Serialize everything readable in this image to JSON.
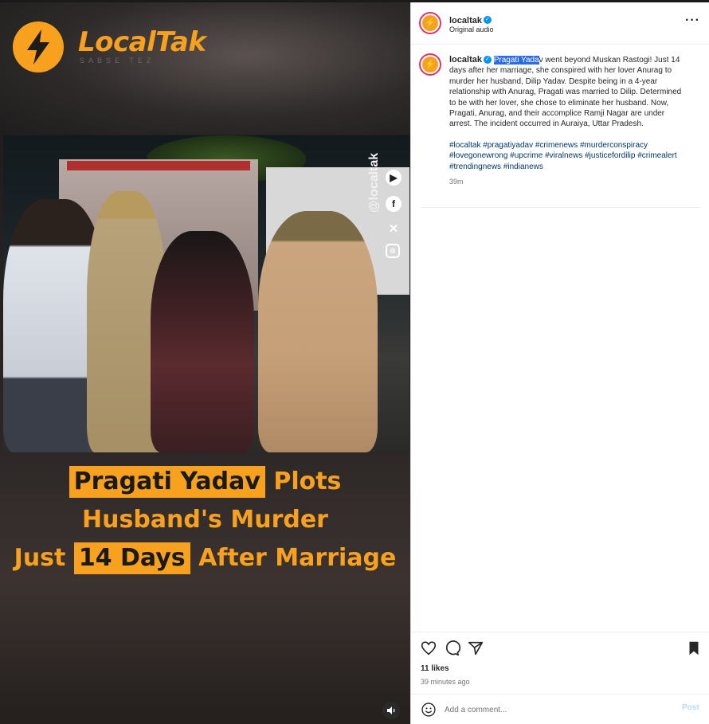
{
  "media": {
    "logo_name": "LocalTak",
    "logo_tagline": "SABSE TEZ",
    "watermark_handle": "@localtak",
    "caption_lines": [
      {
        "highlight": "Pragati Yadav",
        "rest": " Plots"
      },
      {
        "plain": "Husband's Murder"
      },
      {
        "pre": "Just ",
        "highlight": "14 Days",
        "post": " After Marriage"
      }
    ],
    "mute_icon": "speaker-icon"
  },
  "header": {
    "username": "localtak",
    "audio": "Original audio",
    "more_icon": "more-options-icon"
  },
  "post": {
    "username": "localtak",
    "selected_text": "Pragati Yada",
    "caption_rest": "v went beyond Muskan Rastogi! Just 14 days after her marriage, she conspired with her lover Anurag to murder her husband, Dilip Yadav. Despite being in a 4-year relationship with Anurag, Pragati was married to Dilip. Determined to be with her lover, she chose to eliminate her husband. Now, Pragati, Anurag, and their accomplice Ramji Nagar are under arrest. The incident occurred in Auraiya, Uttar Pradesh.",
    "hashtags": "#localtak #pragatiyadav #crimenews #murderconspiracy #lovegonewrong #upcrime #viralnews #justicefordilip #crimealert #trendingnews #indianews",
    "time": "39m"
  },
  "footer": {
    "likes": "11 likes",
    "posted": "39 minutes ago",
    "comment_placeholder": "Add a comment...",
    "post_label": "Post"
  },
  "colors": {
    "brand": "#f7a11f",
    "link": "#00376b",
    "verified": "#0095f6"
  }
}
